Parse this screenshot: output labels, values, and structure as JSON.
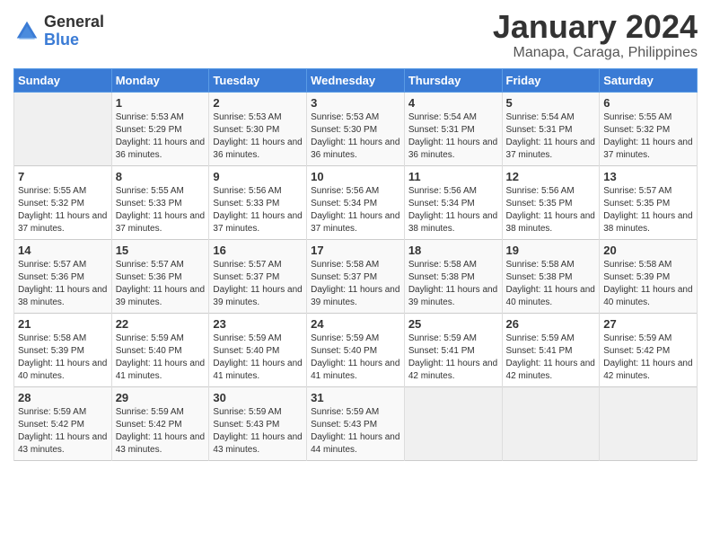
{
  "logo": {
    "general": "General",
    "blue": "Blue"
  },
  "title": "January 2024",
  "location": "Manapa, Caraga, Philippines",
  "days_of_week": [
    "Sunday",
    "Monday",
    "Tuesday",
    "Wednesday",
    "Thursday",
    "Friday",
    "Saturday"
  ],
  "weeks": [
    [
      {
        "day": "",
        "sunrise": "",
        "sunset": "",
        "daylight": ""
      },
      {
        "day": "1",
        "sunrise": "Sunrise: 5:53 AM",
        "sunset": "Sunset: 5:29 PM",
        "daylight": "Daylight: 11 hours and 36 minutes."
      },
      {
        "day": "2",
        "sunrise": "Sunrise: 5:53 AM",
        "sunset": "Sunset: 5:30 PM",
        "daylight": "Daylight: 11 hours and 36 minutes."
      },
      {
        "day": "3",
        "sunrise": "Sunrise: 5:53 AM",
        "sunset": "Sunset: 5:30 PM",
        "daylight": "Daylight: 11 hours and 36 minutes."
      },
      {
        "day": "4",
        "sunrise": "Sunrise: 5:54 AM",
        "sunset": "Sunset: 5:31 PM",
        "daylight": "Daylight: 11 hours and 36 minutes."
      },
      {
        "day": "5",
        "sunrise": "Sunrise: 5:54 AM",
        "sunset": "Sunset: 5:31 PM",
        "daylight": "Daylight: 11 hours and 37 minutes."
      },
      {
        "day": "6",
        "sunrise": "Sunrise: 5:55 AM",
        "sunset": "Sunset: 5:32 PM",
        "daylight": "Daylight: 11 hours and 37 minutes."
      }
    ],
    [
      {
        "day": "7",
        "sunrise": "Sunrise: 5:55 AM",
        "sunset": "Sunset: 5:32 PM",
        "daylight": "Daylight: 11 hours and 37 minutes."
      },
      {
        "day": "8",
        "sunrise": "Sunrise: 5:55 AM",
        "sunset": "Sunset: 5:33 PM",
        "daylight": "Daylight: 11 hours and 37 minutes."
      },
      {
        "day": "9",
        "sunrise": "Sunrise: 5:56 AM",
        "sunset": "Sunset: 5:33 PM",
        "daylight": "Daylight: 11 hours and 37 minutes."
      },
      {
        "day": "10",
        "sunrise": "Sunrise: 5:56 AM",
        "sunset": "Sunset: 5:34 PM",
        "daylight": "Daylight: 11 hours and 37 minutes."
      },
      {
        "day": "11",
        "sunrise": "Sunrise: 5:56 AM",
        "sunset": "Sunset: 5:34 PM",
        "daylight": "Daylight: 11 hours and 38 minutes."
      },
      {
        "day": "12",
        "sunrise": "Sunrise: 5:56 AM",
        "sunset": "Sunset: 5:35 PM",
        "daylight": "Daylight: 11 hours and 38 minutes."
      },
      {
        "day": "13",
        "sunrise": "Sunrise: 5:57 AM",
        "sunset": "Sunset: 5:35 PM",
        "daylight": "Daylight: 11 hours and 38 minutes."
      }
    ],
    [
      {
        "day": "14",
        "sunrise": "Sunrise: 5:57 AM",
        "sunset": "Sunset: 5:36 PM",
        "daylight": "Daylight: 11 hours and 38 minutes."
      },
      {
        "day": "15",
        "sunrise": "Sunrise: 5:57 AM",
        "sunset": "Sunset: 5:36 PM",
        "daylight": "Daylight: 11 hours and 39 minutes."
      },
      {
        "day": "16",
        "sunrise": "Sunrise: 5:57 AM",
        "sunset": "Sunset: 5:37 PM",
        "daylight": "Daylight: 11 hours and 39 minutes."
      },
      {
        "day": "17",
        "sunrise": "Sunrise: 5:58 AM",
        "sunset": "Sunset: 5:37 PM",
        "daylight": "Daylight: 11 hours and 39 minutes."
      },
      {
        "day": "18",
        "sunrise": "Sunrise: 5:58 AM",
        "sunset": "Sunset: 5:38 PM",
        "daylight": "Daylight: 11 hours and 39 minutes."
      },
      {
        "day": "19",
        "sunrise": "Sunrise: 5:58 AM",
        "sunset": "Sunset: 5:38 PM",
        "daylight": "Daylight: 11 hours and 40 minutes."
      },
      {
        "day": "20",
        "sunrise": "Sunrise: 5:58 AM",
        "sunset": "Sunset: 5:39 PM",
        "daylight": "Daylight: 11 hours and 40 minutes."
      }
    ],
    [
      {
        "day": "21",
        "sunrise": "Sunrise: 5:58 AM",
        "sunset": "Sunset: 5:39 PM",
        "daylight": "Daylight: 11 hours and 40 minutes."
      },
      {
        "day": "22",
        "sunrise": "Sunrise: 5:59 AM",
        "sunset": "Sunset: 5:40 PM",
        "daylight": "Daylight: 11 hours and 41 minutes."
      },
      {
        "day": "23",
        "sunrise": "Sunrise: 5:59 AM",
        "sunset": "Sunset: 5:40 PM",
        "daylight": "Daylight: 11 hours and 41 minutes."
      },
      {
        "day": "24",
        "sunrise": "Sunrise: 5:59 AM",
        "sunset": "Sunset: 5:40 PM",
        "daylight": "Daylight: 11 hours and 41 minutes."
      },
      {
        "day": "25",
        "sunrise": "Sunrise: 5:59 AM",
        "sunset": "Sunset: 5:41 PM",
        "daylight": "Daylight: 11 hours and 42 minutes."
      },
      {
        "day": "26",
        "sunrise": "Sunrise: 5:59 AM",
        "sunset": "Sunset: 5:41 PM",
        "daylight": "Daylight: 11 hours and 42 minutes."
      },
      {
        "day": "27",
        "sunrise": "Sunrise: 5:59 AM",
        "sunset": "Sunset: 5:42 PM",
        "daylight": "Daylight: 11 hours and 42 minutes."
      }
    ],
    [
      {
        "day": "28",
        "sunrise": "Sunrise: 5:59 AM",
        "sunset": "Sunset: 5:42 PM",
        "daylight": "Daylight: 11 hours and 43 minutes."
      },
      {
        "day": "29",
        "sunrise": "Sunrise: 5:59 AM",
        "sunset": "Sunset: 5:42 PM",
        "daylight": "Daylight: 11 hours and 43 minutes."
      },
      {
        "day": "30",
        "sunrise": "Sunrise: 5:59 AM",
        "sunset": "Sunset: 5:43 PM",
        "daylight": "Daylight: 11 hours and 43 minutes."
      },
      {
        "day": "31",
        "sunrise": "Sunrise: 5:59 AM",
        "sunset": "Sunset: 5:43 PM",
        "daylight": "Daylight: 11 hours and 44 minutes."
      },
      {
        "day": "",
        "sunrise": "",
        "sunset": "",
        "daylight": ""
      },
      {
        "day": "",
        "sunrise": "",
        "sunset": "",
        "daylight": ""
      },
      {
        "day": "",
        "sunrise": "",
        "sunset": "",
        "daylight": ""
      }
    ]
  ]
}
